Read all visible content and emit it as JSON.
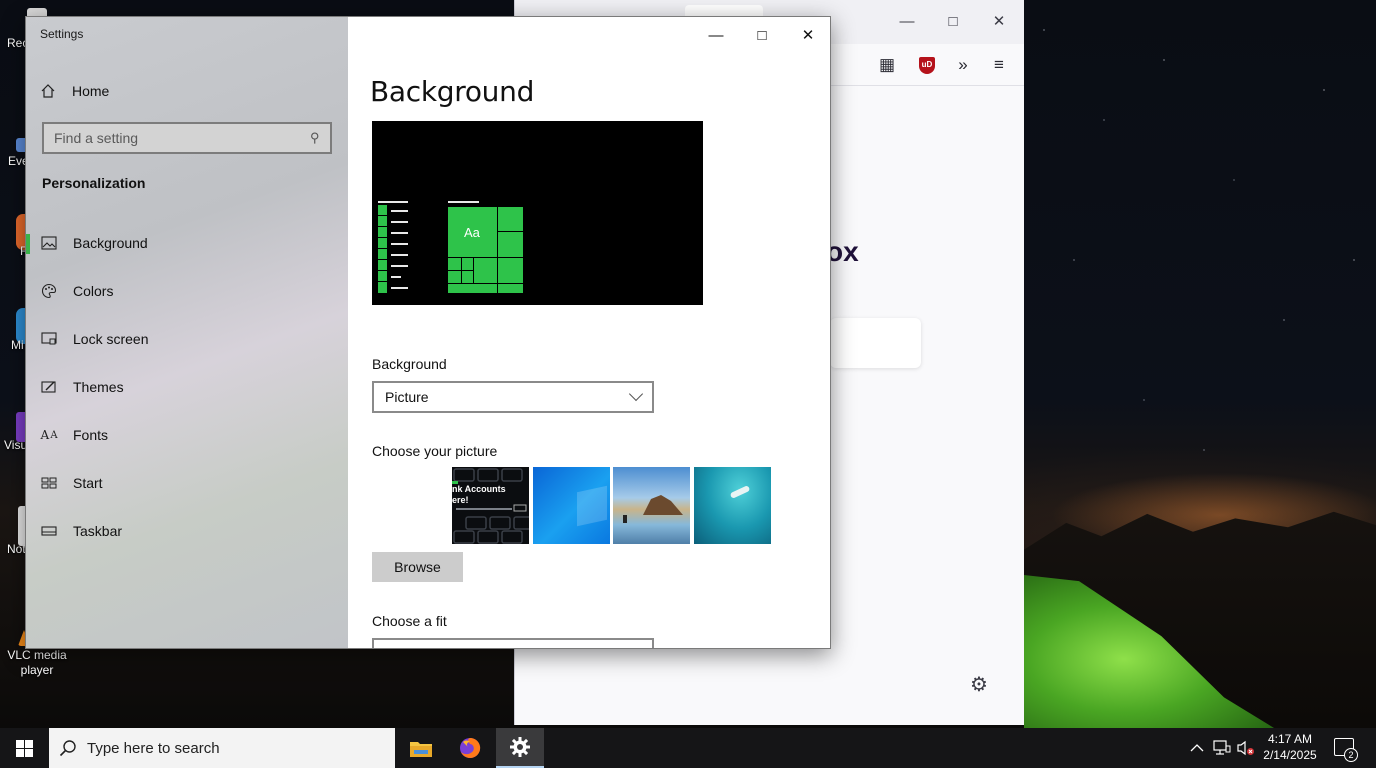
{
  "desktop": {
    "icons": [
      {
        "label": "Rec",
        "color": "#d8d8d8"
      },
      {
        "label": "Eve",
        "color": "#5b8bd8"
      },
      {
        "label": "F",
        "color": "#e76a2c"
      },
      {
        "label": "Mi",
        "color": "#2d8fd6"
      },
      {
        "label": "Visu",
        "color": "#7c3ec8"
      },
      {
        "label": "Not",
        "color": "#e8e8e8"
      },
      {
        "label": "VLC media player",
        "color": "#f08a19"
      }
    ]
  },
  "firefox": {
    "heading_fragment": "ox",
    "toolbar_icons": [
      "extensions-icon",
      "ublock-icon",
      "overflow-chevron-icon",
      "menu-icon"
    ],
    "ublock_label": "uD"
  },
  "settings": {
    "window_title": "Settings",
    "home_label": "Home",
    "search_placeholder": "Find a setting",
    "section_title": "Personalization",
    "nav_items": [
      {
        "label": "Background",
        "icon": "picture-icon",
        "active": true
      },
      {
        "label": "Colors",
        "icon": "palette-icon",
        "active": false
      },
      {
        "label": "Lock screen",
        "icon": "lock-screen-icon",
        "active": false
      },
      {
        "label": "Themes",
        "icon": "themes-icon",
        "active": false
      },
      {
        "label": "Fonts",
        "icon": "fonts-icon",
        "active": false
      },
      {
        "label": "Start",
        "icon": "start-icon",
        "active": false
      },
      {
        "label": "Taskbar",
        "icon": "taskbar-icon",
        "active": false
      }
    ],
    "page_title": "Background",
    "preview_tile_text": "Aa",
    "background_label": "Background",
    "background_value": "Picture",
    "choose_picture_label": "Choose your picture",
    "browse_label": "Browse",
    "choose_fit_label": "Choose a fit",
    "accent_color": "#2ec34a",
    "thumbnails": [
      {
        "name": "account-banner-thumbnail",
        "text_lines": [
          "nk Accounts",
          "ere!"
        ]
      },
      {
        "name": "windows-blue-thumbnail"
      },
      {
        "name": "beach-rocks-thumbnail"
      },
      {
        "name": "underwater-swimmer-thumbnail"
      }
    ]
  },
  "taskbar": {
    "search_placeholder": "Type here to search",
    "apps": [
      "file-explorer-icon",
      "firefox-icon",
      "settings-icon"
    ],
    "time": "4:17 AM",
    "date": "2/14/2025",
    "notification_count": "2"
  }
}
